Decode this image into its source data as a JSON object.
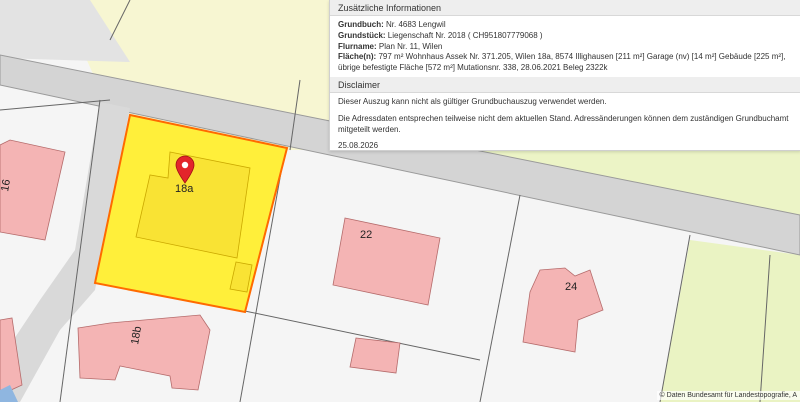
{
  "info_panel": {
    "section_title": "Zusätzliche Informationen",
    "fields": [
      {
        "label": "Grundbuch:",
        "value": "Nr. 4683 Lengwil"
      },
      {
        "label": "Grundstück:",
        "value": "Liegenschaft Nr. 2018 ( CH951807779068 )"
      },
      {
        "label": "Flurname:",
        "value": "Plan Nr. 11, Wilen"
      },
      {
        "label": "Fläche(n):",
        "value": "797 m² Wohnhaus Assek Nr. 371.205, Wilen 18a, 8574 Illighausen [211 m²] Garage (nv) [14 m²] Gebäude [225 m²], übrige befestigte Fläche [572 m²] Mutationsnr. 338, 28.06.2021 Beleg 2322k"
      }
    ],
    "disclaimer_title": "Disclaimer",
    "disclaimer_text_1": "Dieser Auszug kann nicht als gültiger Grundbuchauszug verwendet werden.",
    "disclaimer_text_2": "Die Adressdaten entsprechen teilweise nicht dem aktuellen Stand. Adressänderungen können dem zuständigen Grundbuchamt mitgeteilt werden.",
    "date": "25.08.2026"
  },
  "map": {
    "building_labels": [
      "18a",
      "22",
      "24",
      "18b",
      "16"
    ],
    "attribution": "© Daten Bundesamt für Landestopografie, A",
    "colors": {
      "parcel_highlight": "#ffef3a",
      "parcel_border": "#ff6a00",
      "building": "#f4b4b4",
      "road": "#d0d0d0",
      "meadow": "#ecf4c6",
      "marker": "#e3252b"
    }
  }
}
